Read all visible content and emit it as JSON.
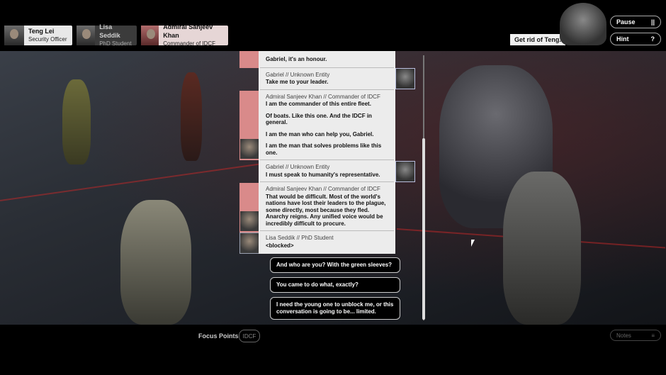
{
  "characters": [
    {
      "name": "Teng Lei",
      "role": "Security Officer"
    },
    {
      "name": "Lisa Seddik",
      "role": "PhD Student"
    },
    {
      "name": "Admiral Sanjeev Khan",
      "role": "Commander of IDCF"
    }
  ],
  "objective": "Get rid of Teng.",
  "menu": {
    "pause_label": "Pause",
    "pause_icon": "||",
    "hint_label": "Hint",
    "hint_icon": "?"
  },
  "dialog": [
    {
      "speaker": "",
      "lines": [
        "Gabriel, it's an honour."
      ]
    },
    {
      "speaker": "Gabriel // Unknown Entity",
      "lines": [
        "Take me to your leader."
      ]
    },
    {
      "speaker": "Admiral Sanjeev Khan // Commander of IDCF",
      "lines": [
        "I am the commander of this entire fleet.",
        "Of boats. Like this one. And the IDCF in general.",
        "I am the man who can help you, Gabriel.",
        "I am the man that solves problems like this one."
      ]
    },
    {
      "speaker": "Gabriel // Unknown Entity",
      "lines": [
        "I must speak to humanity's representative."
      ]
    },
    {
      "speaker": "Admiral Sanjeev Khan // Commander of IDCF",
      "lines": [
        "That would be difficult. Most of the world's nations have lost their leaders to the plague, some directly, most because they fled. Anarchy reigns. Any unified voice would be incredibly difficult to procure."
      ]
    },
    {
      "speaker": "Lisa Seddik // PhD Student",
      "lines": [
        "<blocked>"
      ]
    }
  ],
  "choices": [
    "And who are you? With the green sleeves?",
    "You came to do what, exactly?",
    "I need the young one to unblock me, or this conversation is going to be... limited."
  ],
  "bottom": {
    "focus_label": "Focus Points",
    "focus_chip": "IDCF",
    "notes_label": "Notes"
  }
}
